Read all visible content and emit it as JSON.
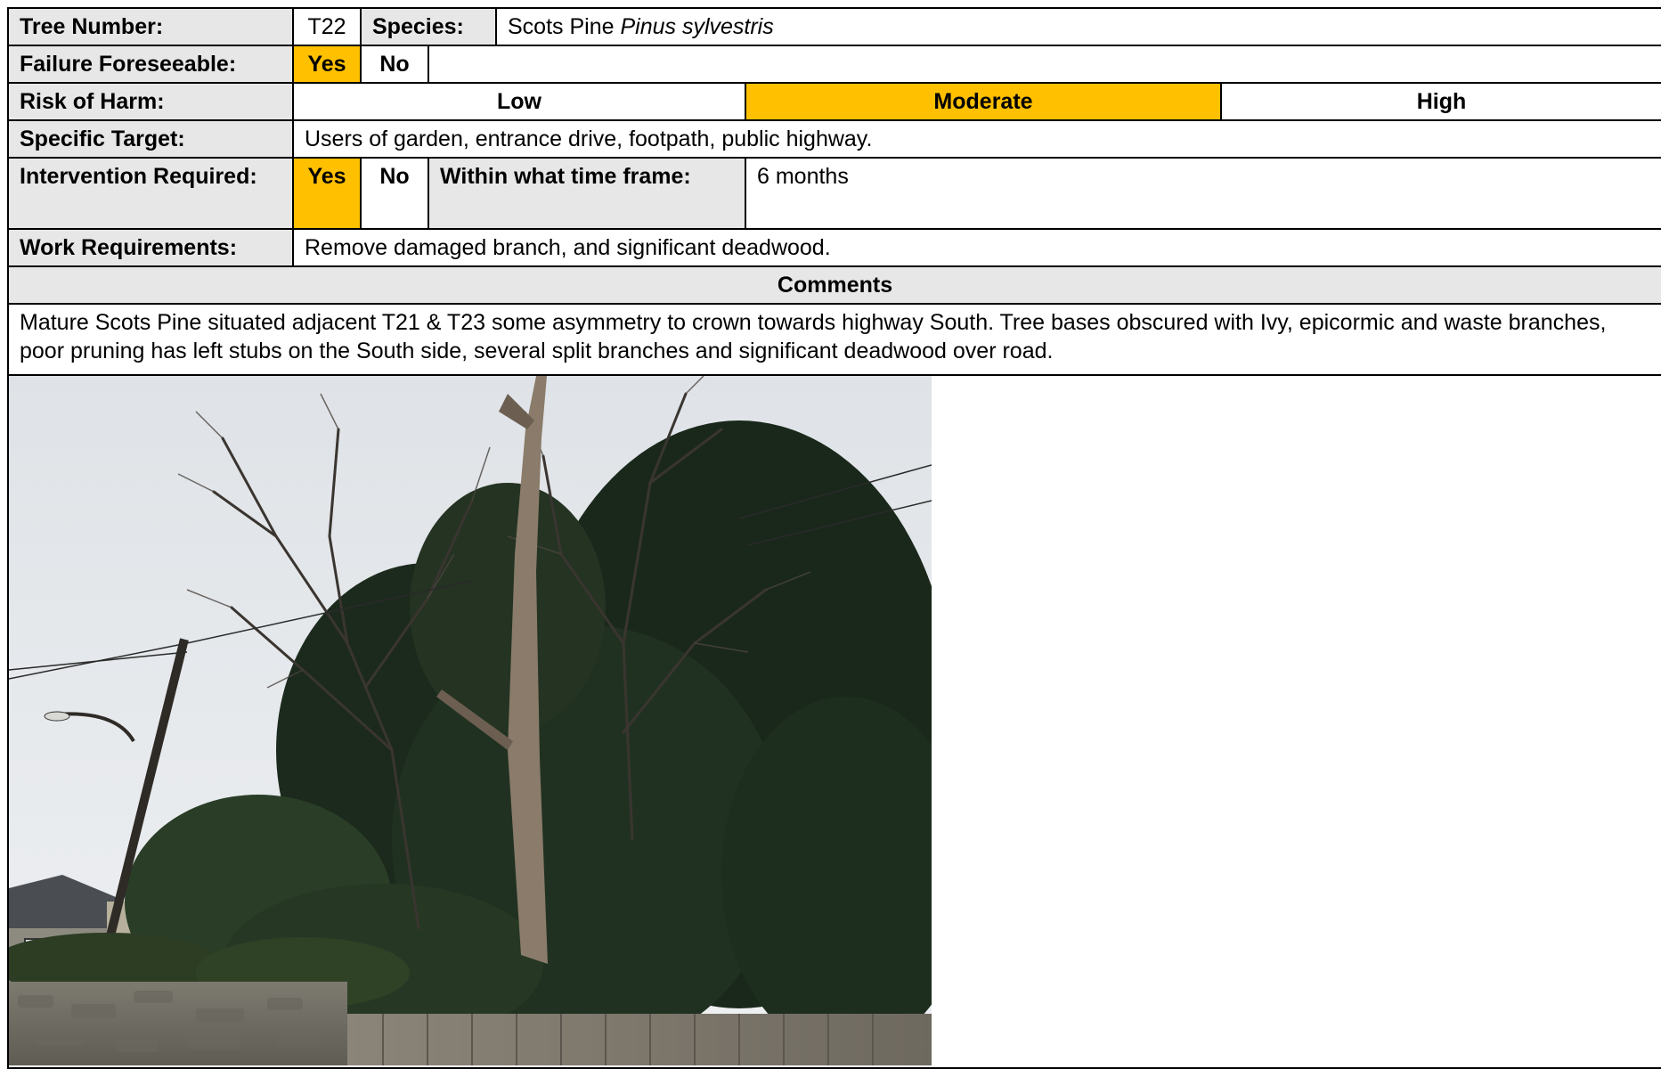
{
  "tree_number": {
    "label": "Tree Number:",
    "value": "T22"
  },
  "species": {
    "label": "Species:",
    "common": "Scots Pine",
    "latin": "Pinus sylvestris"
  },
  "failure_foreseeable": {
    "label": "Failure Foreseeable:",
    "yes": "Yes",
    "no": "No",
    "selected": "Yes"
  },
  "risk_of_harm": {
    "label": "Risk of Harm:",
    "low": "Low",
    "moderate": "Moderate",
    "high": "High",
    "selected": "Moderate"
  },
  "specific_target": {
    "label": "Specific Target:",
    "value": "Users of garden, entrance drive, footpath, public highway."
  },
  "intervention": {
    "label": "Intervention Required:",
    "yes": "Yes",
    "no": "No",
    "selected": "Yes",
    "timeframe_label": "Within what time frame:",
    "timeframe_value": "6 months"
  },
  "work_requirements": {
    "label": "Work Requirements:",
    "value": "Remove damaged branch, and significant deadwood."
  },
  "comments": {
    "heading": "Comments",
    "text": "Mature Scots Pine situated adjacent T21 & T23 some asymmetry to crown towards highway South. Tree bases obscured with Ivy, epicormic and waste branches, poor pruning has left stubs on the South side, several split branches and significant deadwood over road."
  },
  "colors": {
    "highlight": "#ffc000",
    "label_bg": "#e7e7e7"
  }
}
